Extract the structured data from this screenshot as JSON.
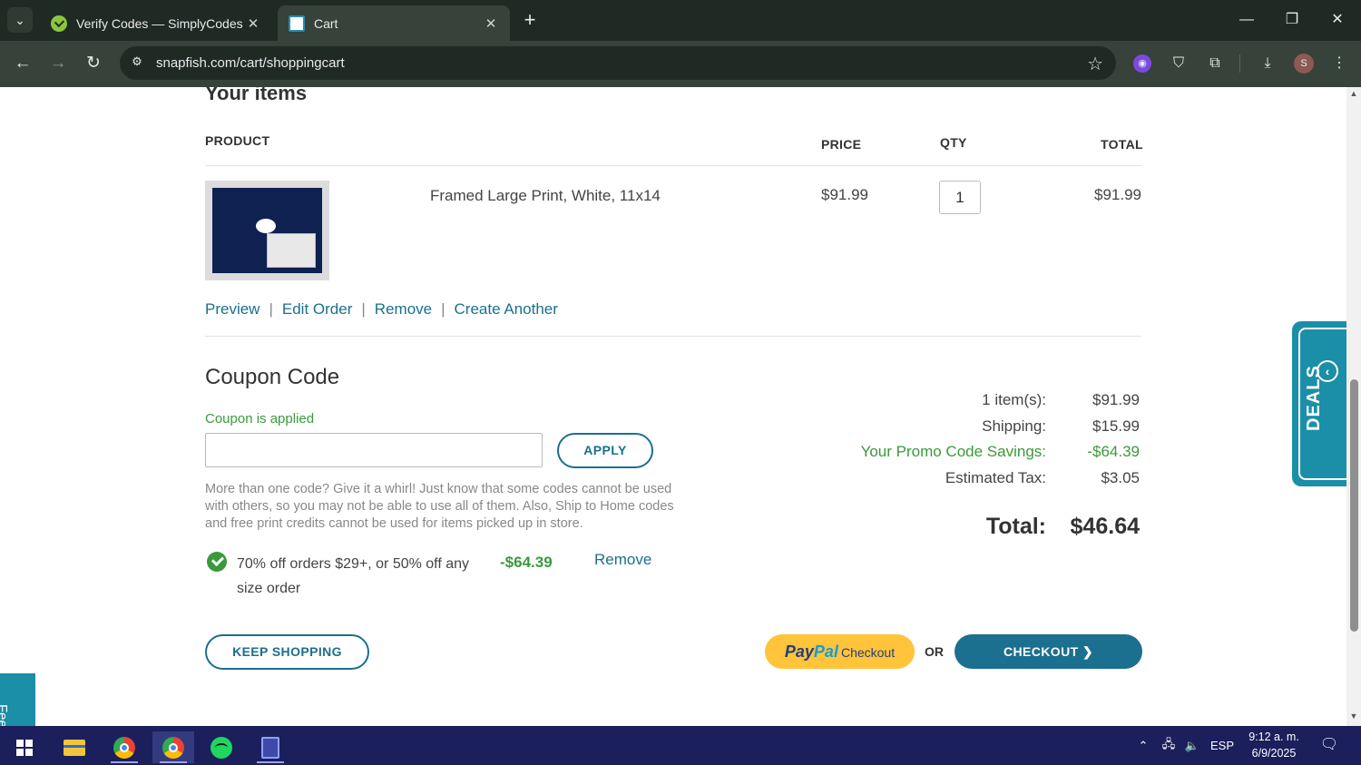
{
  "browser": {
    "tabs": [
      {
        "title": "Verify Codes — SimplyCodes",
        "active": false
      },
      {
        "title": "Cart",
        "active": true
      }
    ],
    "url": "snapfish.com/cart/shoppingcart",
    "profile_initial": "S"
  },
  "cart": {
    "section_title": "Your items",
    "columns": {
      "product": "PRODUCT",
      "price": "PRICE",
      "qty": "QTY",
      "total": "TOTAL"
    },
    "items": [
      {
        "name": "Framed Large Print, White, 11x14",
        "price": "$91.99",
        "qty": "1",
        "total": "$91.99"
      }
    ],
    "item_actions": [
      "Preview",
      "Edit Order",
      "Remove",
      "Create Another"
    ]
  },
  "coupon": {
    "title": "Coupon Code",
    "status": "Coupon is applied",
    "input_value": "",
    "apply_label": "APPLY",
    "help": "More than one code? Give it a whirl! Just know that some codes cannot be used with others, so you may not be able to use all of them. Also, Ship to Home codes and free print credits cannot be used for items picked up in store.",
    "applied": {
      "description": "70% off orders $29+, or 50% off any size order",
      "amount": "-$64.39",
      "remove_label": "Remove"
    }
  },
  "summary": {
    "rows": [
      {
        "label": "1 item(s):",
        "value": "$91.99"
      },
      {
        "label": "Shipping:",
        "value": "$15.99"
      },
      {
        "label": "Your Promo Code Savings:",
        "value": "-$64.39"
      },
      {
        "label": "Estimated Tax:",
        "value": "$3.05"
      }
    ],
    "total_label": "Total:",
    "total_value": "$46.64"
  },
  "actions": {
    "keep_shopping": "KEEP SHOPPING",
    "paypal_part1": "Pay",
    "paypal_part2": "Pal",
    "paypal_checkout": "Checkout",
    "or": "OR",
    "checkout": "CHECKOUT ❯"
  },
  "side_tabs": {
    "deals": "DEALS",
    "feedback": "Fee"
  },
  "taskbar": {
    "language": "ESP",
    "time": "9:12 a. m.",
    "date": "6/9/2025"
  },
  "colors": {
    "brand_teal": "#1b6f8f",
    "promo_green": "#3a9a3a",
    "paypal_yellow": "#ffc439",
    "deals_tab": "#1b8ea8"
  }
}
